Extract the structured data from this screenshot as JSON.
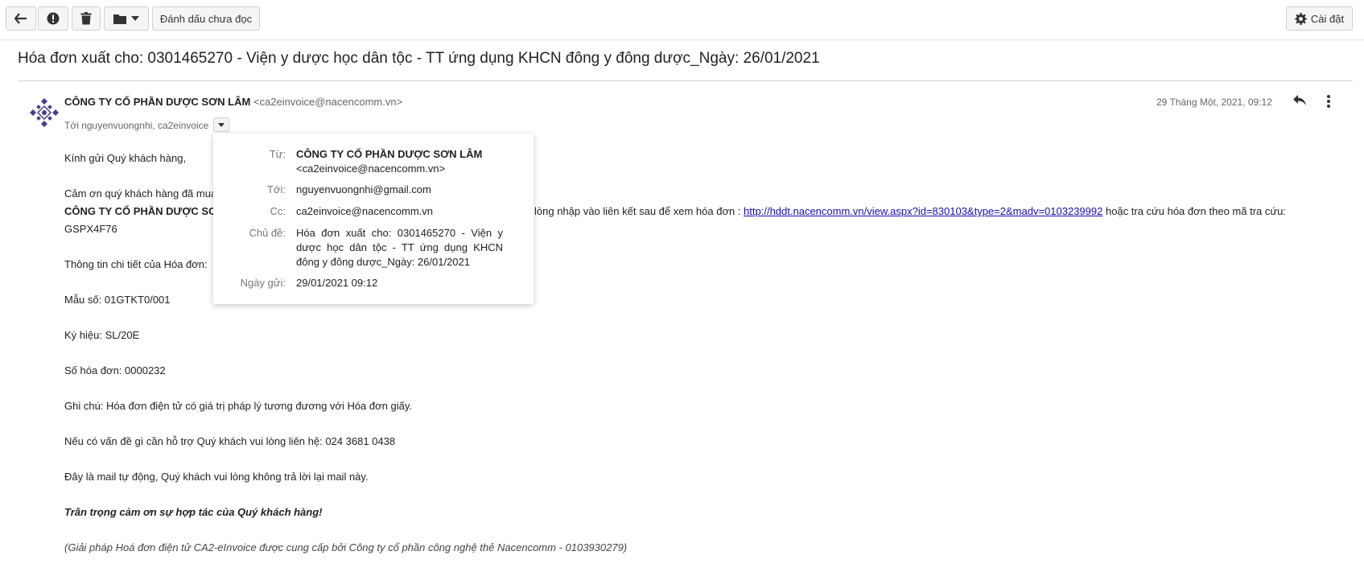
{
  "toolbar": {
    "back_icon": "arrow-left-icon",
    "spam_icon": "exclamation-circle-icon",
    "delete_icon": "trash-icon",
    "move_icon": "folder-icon",
    "mark_unread_label": "Đánh dấu chưa đọc",
    "settings_label": "Cài đặt"
  },
  "email": {
    "subject": "Hóa đơn xuất cho: 0301465270 - Viện y dược học dân tộc - TT ứng dụng KHCN đông y đông dược_Ngày: 26/01/2021",
    "sender_name": "CÔNG TY CỔ PHẦN DƯỢC SƠN LÂM",
    "sender_email": "<ca2einvoice@nacencomm.vn>",
    "to_line": "Tới nguyenvuongnhi, ca2einvoice",
    "date": "29 Tháng Một, 2021, 09:12"
  },
  "details_popup": {
    "from_label": "Từ:",
    "from_name": "CÔNG TY CỔ PHẦN DƯỢC SƠN LÂM",
    "from_email": "<ca2einvoice@nacencomm.vn>",
    "to_label": "Tới:",
    "to_value": "nguyenvuongnhi@gmail.com",
    "cc_label": "Cc:",
    "cc_value": "ca2einvoice@nacencomm.vn",
    "subject_label": "Chủ đề:",
    "subject_value": "Hóa đơn xuất cho: 0301465270 - Viện y dược học dân tộc - TT ứng dụng KHCN đông y đông dược_Ngày: 26/01/2021",
    "date_label": "Ngày gửi:",
    "date_value": "29/01/2021 09:12"
  },
  "body": {
    "greeting": "Kính gửi Quý khách hàng,",
    "thanks_start": "Cảm ơn quý khách hàng đã mua",
    "company_start": "CÔNG TY CỔ PHẦN DƯỢC SƠ",
    "link_prefix": "lòng nhập vào liên kết sau để xem hóa đơn :",
    "link_url": "http://hddt.nacencomm.vn/view.aspx?id=830103&type=2&madv=0103239992",
    "link_suffix": "hoặc tra cứu hóa đơn theo mã tra cứu:",
    "lookup_code": "GSPX4F76",
    "details_heading": "Thông tin chi tiết của Hóa đơn:",
    "form_no": "Mẫu số: 01GTKT0/001",
    "symbol": "Ký hiệu: SL/20E",
    "invoice_no": "Số hóa đơn: 0000232",
    "note": "Ghi chú: Hóa đơn điện tử có giá trị pháp lý tương đương với Hóa đơn giấy.",
    "support": "Nếu có vấn đề gì cần hỗ trợ Quý khách vui lòng liên hệ: 024 3681 0438",
    "auto_mail": "Đây là mail tự động, Quý khách vui lòng không trả lời lại mail này.",
    "regards": "Trân trọng cảm ơn sự hợp tác của Quý khách hàng!",
    "footer": "(Giải pháp Hoá đơn điện tử CA2-eInvoice được cung cấp bởi Công ty cổ phần công nghệ thẻ Nacencomm - 0103930279)"
  }
}
